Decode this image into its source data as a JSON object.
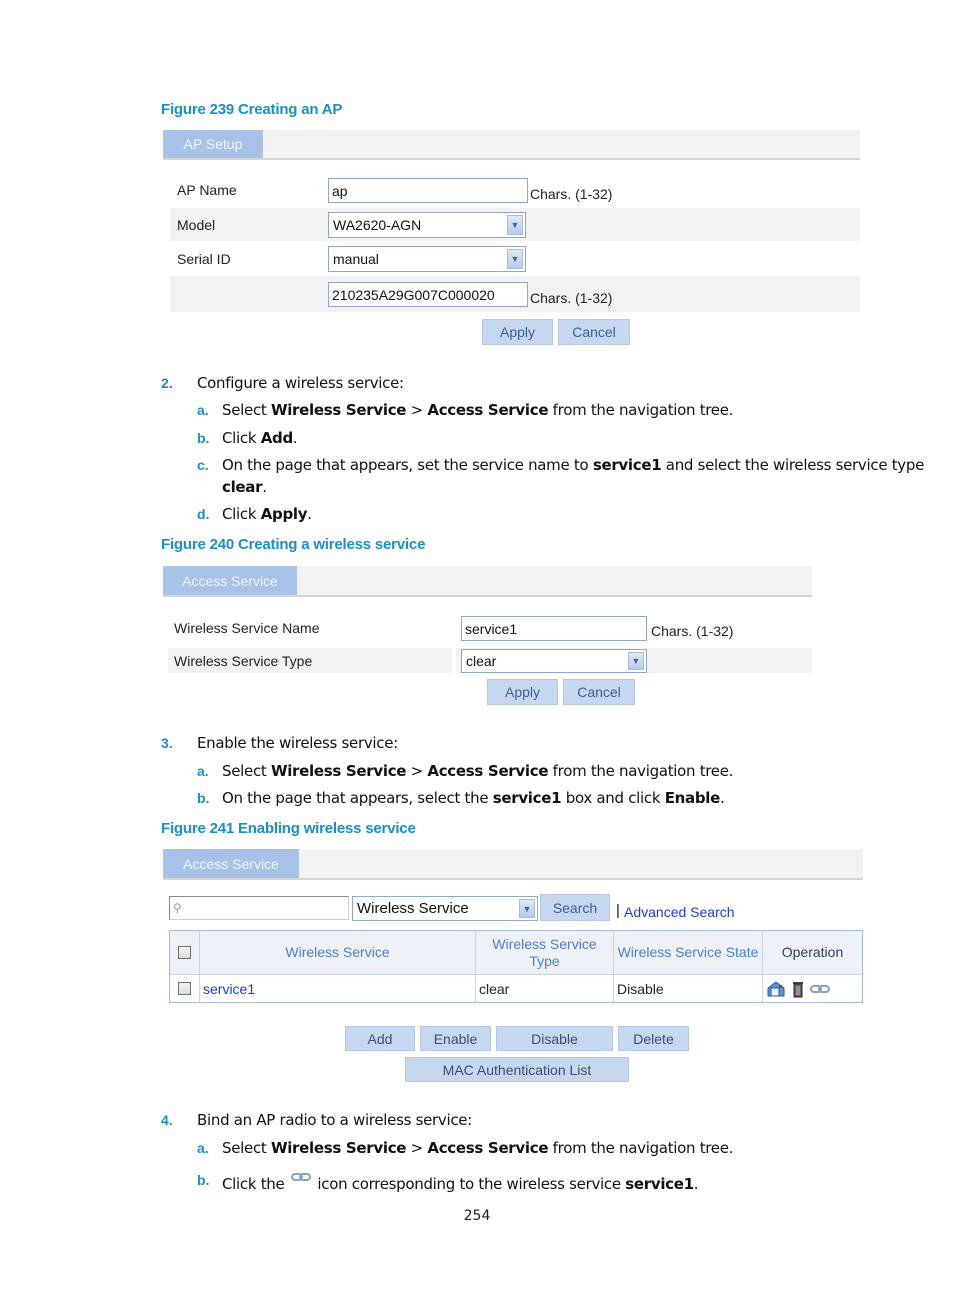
{
  "figures": {
    "fig239": {
      "caption": "Figure 239 Creating an AP",
      "tab": "AP Setup",
      "fields": {
        "ap_name_label": "AP Name",
        "ap_name_value": "ap",
        "ap_name_hint": "Chars. (1-32)",
        "model_label": "Model",
        "model_value": "WA2620-AGN",
        "serial_label": "Serial ID",
        "serial_value": "manual",
        "serial_number_value": "210235A29G007C000020",
        "serial_number_hint": "Chars. (1-32)"
      },
      "buttons": {
        "apply": "Apply",
        "cancel": "Cancel"
      }
    },
    "fig240": {
      "caption": "Figure 240 Creating a wireless service",
      "tab": "Access Service",
      "fields": {
        "name_label": "Wireless Service Name",
        "name_value": "service1",
        "name_hint": "Chars. (1-32)",
        "type_label": "Wireless Service Type",
        "type_value": "clear"
      },
      "buttons": {
        "apply": "Apply",
        "cancel": "Cancel"
      }
    },
    "fig241": {
      "caption": "Figure 241 Enabling wireless service",
      "tab": "Access Service",
      "search": {
        "placeholder": "",
        "filter_value": "Wireless Service",
        "search_button": "Search",
        "separator": "|",
        "advanced_link": "Advanced Search"
      },
      "table": {
        "headers": [
          "",
          "Wireless Service",
          "Wireless Service Type",
          "Wireless Service State",
          "Operation"
        ],
        "rows": [
          {
            "checked": false,
            "service": "service1",
            "type": "clear",
            "state": "Disable",
            "operations": [
              "summary-icon",
              "delete-icon",
              "bind-icon"
            ]
          }
        ]
      },
      "buttons": {
        "add": "Add",
        "enable": "Enable",
        "disable": "Disable",
        "delete": "Delete",
        "mac_list": "MAC Authentication List"
      }
    }
  },
  "steps": {
    "s2": {
      "num": "2.",
      "text": "Configure a wireless service:",
      "a": {
        "letter": "a.",
        "pre": "Select ",
        "b1": "Wireless Service",
        "mid": " > ",
        "b2": "Access Service",
        "post": " from the navigation tree."
      },
      "b": {
        "letter": "b.",
        "pre": "Click ",
        "b1": "Add",
        "post": "."
      },
      "c": {
        "letter": "c.",
        "pre": "On the page that appears, set the service name to ",
        "b1": "service1",
        "mid": " and select the wireless service type",
        "b2": "clear",
        "post": "."
      },
      "d": {
        "letter": "d.",
        "pre": "Click ",
        "b1": "Apply",
        "post": "."
      }
    },
    "s3": {
      "num": "3.",
      "text": "Enable the wireless service:",
      "a": {
        "letter": "a.",
        "pre": "Select ",
        "b1": "Wireless Service",
        "mid": " > ",
        "b2": "Access Service",
        "post": " from the navigation tree."
      },
      "b": {
        "letter": "b.",
        "pre": "On the page that appears, select the ",
        "b1": "service1",
        "mid": " box and click ",
        "b2": "Enable",
        "post": "."
      }
    },
    "s4": {
      "num": "4.",
      "text": "Bind an AP radio to a wireless service:",
      "a": {
        "letter": "a.",
        "pre": "Select ",
        "b1": "Wireless Service",
        "mid": " > ",
        "b2": "Access Service",
        "post": " from the navigation tree."
      },
      "b": {
        "letter": "b.",
        "pre": "Click the ",
        "icon": "bind-icon",
        "mid": " icon corresponding to the wireless service ",
        "b1": "service1",
        "post": "."
      }
    }
  },
  "page_number": "254",
  "colors": {
    "caption_blue": "#1a8fc9",
    "tab_blue": "#a9c3e8",
    "button_blue": "#c6d7f0",
    "link_blue": "#1b3bd4",
    "header_text": "#4c7cd3"
  }
}
